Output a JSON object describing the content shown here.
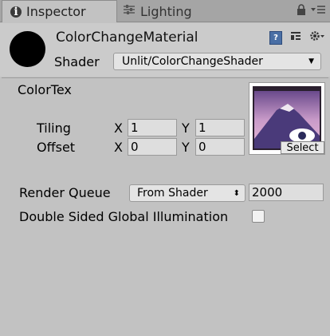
{
  "tabs": {
    "inspector_label": "Inspector",
    "lighting_label": "Lighting"
  },
  "material": {
    "name": "ColorChangeMaterial",
    "shader_label": "Shader",
    "shader_value": "Unlit/ColorChangeShader"
  },
  "texture": {
    "label": "ColorTex",
    "select_label": "Select",
    "tiling_label": "Tiling",
    "offset_label": "Offset",
    "x_label": "X",
    "y_label": "Y",
    "tiling_x": "1",
    "tiling_y": "1",
    "offset_x": "0",
    "offset_y": "0"
  },
  "render_queue": {
    "label": "Render Queue",
    "mode": "From Shader",
    "value": "2000"
  },
  "gi": {
    "label": "Double Sided Global Illumination",
    "checked": false
  },
  "colors": {
    "background": "#c2c2c2",
    "tabbar": "#a5a5a5",
    "field": "#dedede"
  }
}
